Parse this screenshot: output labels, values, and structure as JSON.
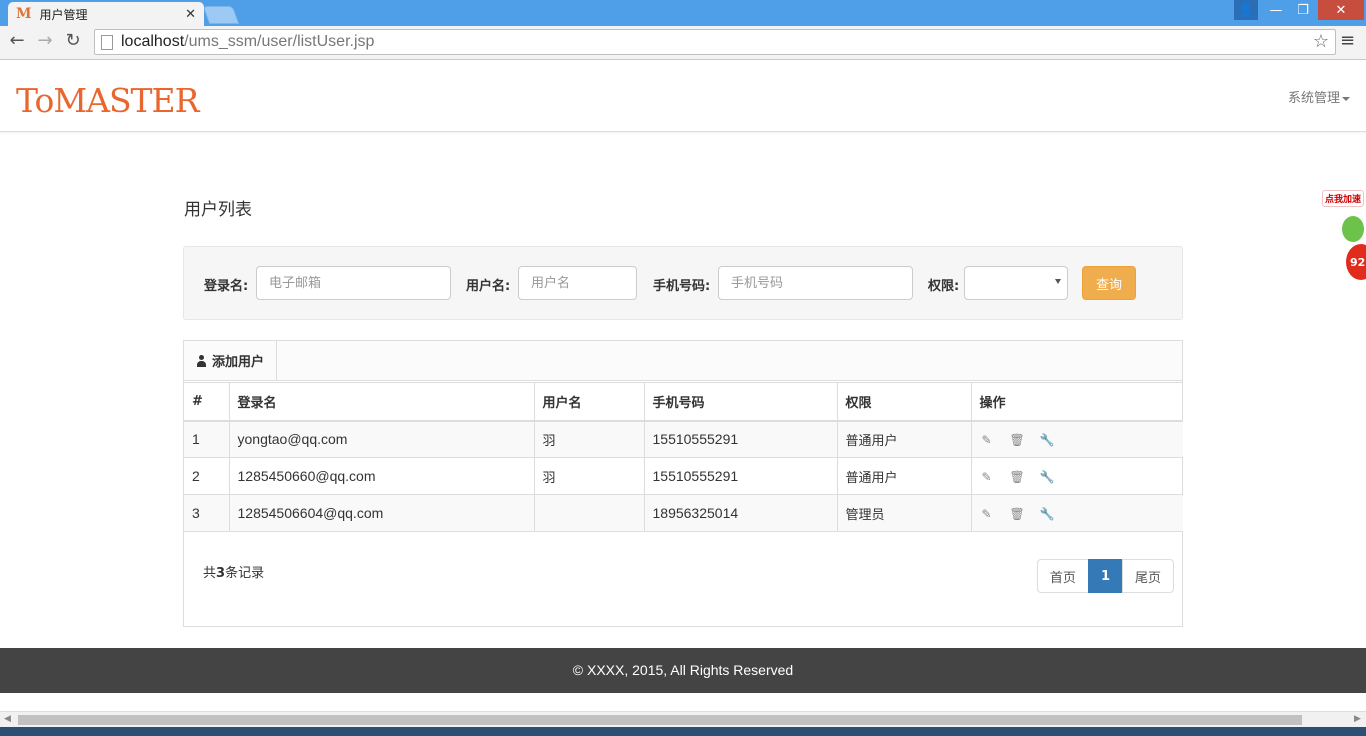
{
  "browser": {
    "tab_title": "用户管理",
    "tab_favicon": "M",
    "url_host": "localhost",
    "url_path": "/ums_ssm/user/listUser.jsp"
  },
  "navbar": {
    "logo": "ToMASTER",
    "menu_label": "系统管理"
  },
  "page": {
    "title": "用户列表"
  },
  "search": {
    "login_label": "登录名:",
    "login_placeholder": "电子邮箱",
    "username_label": "用户名:",
    "username_placeholder": "用户名",
    "phone_label": "手机号码:",
    "phone_placeholder": "手机号码",
    "role_label": "权限:",
    "role_value": "",
    "query_button": "查询"
  },
  "toolbar": {
    "add_user": "添加用户"
  },
  "table": {
    "headers": [
      "#",
      "登录名",
      "用户名",
      "手机号码",
      "权限",
      "操作"
    ],
    "rows": [
      {
        "id": "1",
        "login": "yongtao@qq.com",
        "name": "羽",
        "phone": "15510555291",
        "role": "普通用户"
      },
      {
        "id": "2",
        "login": "1285450660@qq.com",
        "name": "羽",
        "phone": "15510555291",
        "role": "普通用户"
      },
      {
        "id": "3",
        "login": "12854506604@qq.com",
        "name": "",
        "phone": "18956325014",
        "role": "管理员"
      }
    ],
    "actions": [
      "edit-icon",
      "trash-icon",
      "wrench-icon"
    ]
  },
  "summary": {
    "prefix": "共",
    "count": "3",
    "suffix": "条记录"
  },
  "pagination": {
    "first": "首页",
    "current": "1",
    "last": "尾页"
  },
  "footer": {
    "text": "© XXXX, 2015, All Rights Reserved"
  },
  "widget": {
    "label": "点我加速",
    "value": "92"
  }
}
